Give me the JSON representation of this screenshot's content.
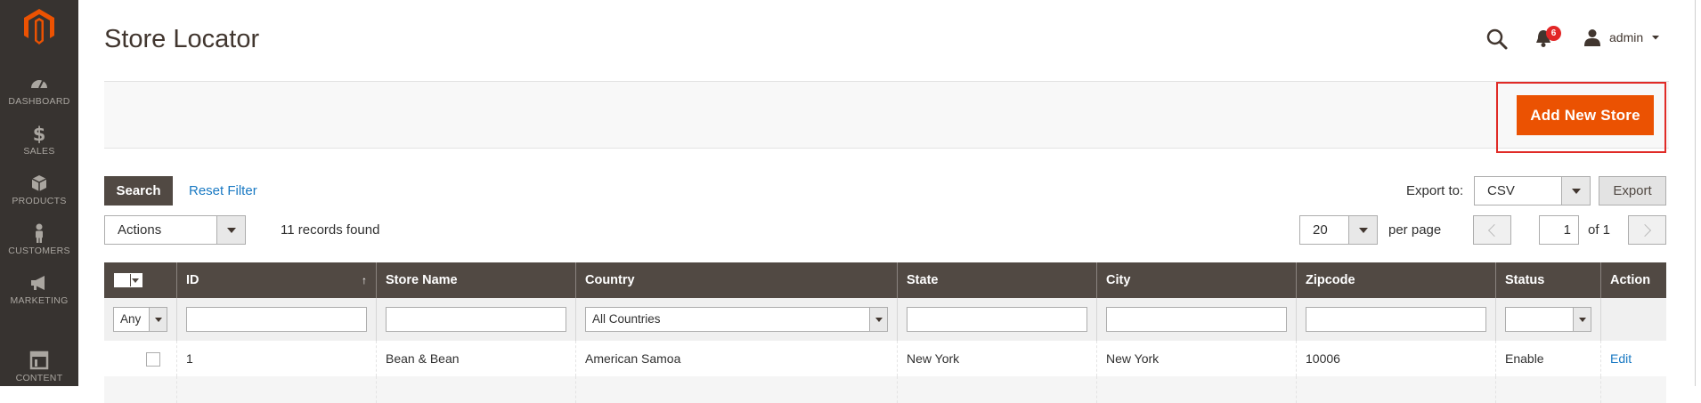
{
  "sidebar": {
    "items": [
      {
        "label": "DASHBOARD",
        "icon": "dashboard-icon"
      },
      {
        "label": "SALES",
        "icon": "dollar-icon"
      },
      {
        "label": "PRODUCTS",
        "icon": "box-icon"
      },
      {
        "label": "CUSTOMERS",
        "icon": "person-icon"
      },
      {
        "label": "MARKETING",
        "icon": "megaphone-icon"
      },
      {
        "label": "CONTENT",
        "icon": "layout-icon"
      }
    ]
  },
  "header": {
    "title": "Store Locator",
    "notifications_count": "6",
    "user": "admin"
  },
  "actions": {
    "add_new_label": "Add New Store"
  },
  "grid_controls": {
    "search_label": "Search",
    "reset_label": "Reset Filter",
    "export_label": "Export to:",
    "export_format": "CSV",
    "export_button": "Export",
    "mass_action": "Actions",
    "records_found": "11 records found",
    "per_page_value": "20",
    "per_page_label": "per page",
    "current_page": "1",
    "total_pages": "of 1"
  },
  "table": {
    "columns": [
      "ID",
      "Store Name",
      "Country",
      "State",
      "City",
      "Zipcode",
      "Status",
      "Action"
    ],
    "filters": {
      "mass_select": "Any",
      "country": "All Countries"
    },
    "rows": [
      {
        "id": "1",
        "store_name": "Bean & Bean",
        "country": "American Samoa",
        "state": "New York",
        "city": "New York",
        "zipcode": "10006",
        "status": "Enable",
        "action": "Edit"
      }
    ]
  },
  "colors": {
    "sidebar": "#373330",
    "accent": "#eb5202",
    "grid_header": "#514943",
    "link": "#1979c3"
  }
}
